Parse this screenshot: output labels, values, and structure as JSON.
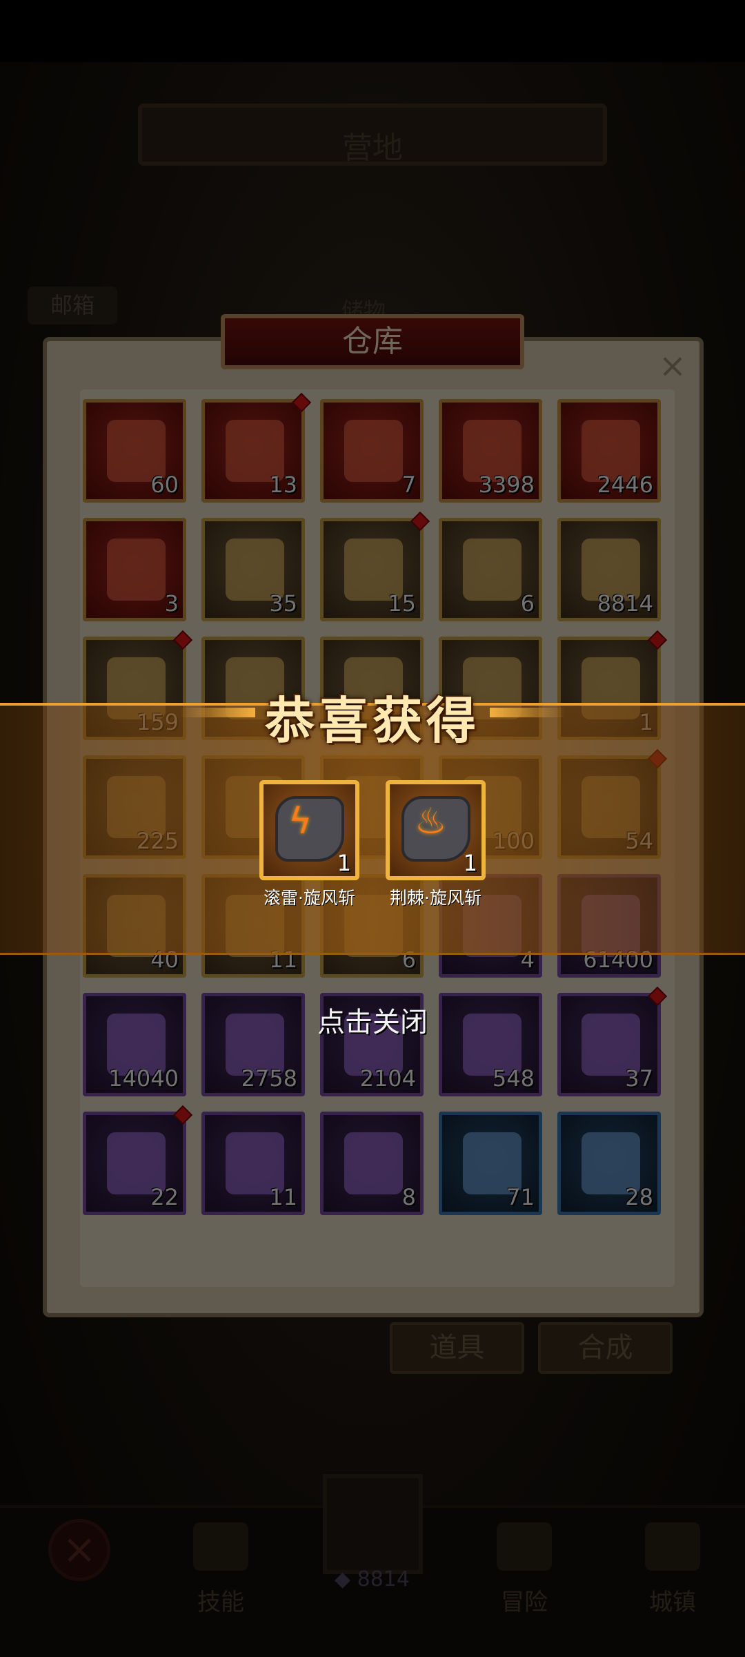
{
  "background": {
    "title": "营地",
    "mailbox": "邮箱",
    "subtitle": "储物",
    "tabs": [
      "道具",
      "合成"
    ],
    "nav": [
      {
        "label": "技能",
        "icon": "book-icon"
      },
      {
        "label": "冒险",
        "icon": "map-icon"
      },
      {
        "label": "城镇",
        "icon": "castle-icon"
      }
    ],
    "gem_count": "8814"
  },
  "warehouse": {
    "title": "仓库",
    "close": "×",
    "items": [
      {
        "count": "60",
        "rarity": "red",
        "icon": "red-potion-icon",
        "alert": false
      },
      {
        "count": "13",
        "rarity": "red",
        "icon": "armor-icon",
        "alert": true
      },
      {
        "count": "7",
        "rarity": "red",
        "icon": "crystal-crown-icon",
        "alert": false
      },
      {
        "count": "3398",
        "rarity": "red",
        "icon": "gold-shard-icon",
        "alert": false
      },
      {
        "count": "2446",
        "rarity": "red",
        "icon": "ruby-icon",
        "alert": false
      },
      {
        "count": "3",
        "rarity": "red",
        "icon": "flame-potion-icon",
        "alert": false
      },
      {
        "count": "35",
        "rarity": "gold",
        "icon": "green-potion-icon",
        "alert": false
      },
      {
        "count": "15",
        "rarity": "gold",
        "icon": "armor-icon",
        "alert": true
      },
      {
        "count": "6",
        "rarity": "gold",
        "icon": "flame-potion-icon",
        "alert": false
      },
      {
        "count": "8814",
        "rarity": "gold",
        "icon": "purple-flame-icon",
        "alert": false
      },
      {
        "count": "159",
        "rarity": "gold",
        "icon": "armor-icon",
        "alert": true
      },
      {
        "count": "",
        "rarity": "gold",
        "icon": "ore-icon",
        "alert": false
      },
      {
        "count": "",
        "rarity": "gold",
        "icon": "ore-icon",
        "alert": false
      },
      {
        "count": "",
        "rarity": "gold",
        "icon": "blue-potion-icon",
        "alert": false
      },
      {
        "count": "1",
        "rarity": "gold",
        "icon": "skull-icon",
        "alert": true
      },
      {
        "count": "225",
        "rarity": "gold",
        "icon": "hammer-icon",
        "alert": false
      },
      {
        "count": "",
        "rarity": "gold",
        "icon": "item-icon",
        "alert": false
      },
      {
        "count": "",
        "rarity": "gold",
        "icon": "item-icon",
        "alert": false
      },
      {
        "count": "100",
        "rarity": "gold",
        "icon": "item-icon",
        "alert": false
      },
      {
        "count": "54",
        "rarity": "gold",
        "icon": "armor-icon",
        "alert": true
      },
      {
        "count": "40",
        "rarity": "gold",
        "icon": "compass-icon",
        "alert": false
      },
      {
        "count": "11",
        "rarity": "gold",
        "icon": "potion-icon",
        "alert": false
      },
      {
        "count": "6",
        "rarity": "gold",
        "icon": "eye-icon",
        "alert": false
      },
      {
        "count": "4",
        "rarity": "purple",
        "icon": "item-icon",
        "alert": false
      },
      {
        "count": "61400",
        "rarity": "purple",
        "icon": "coin-icon",
        "alert": false
      },
      {
        "count": "14040",
        "rarity": "purple",
        "icon": "red-crystals-icon",
        "alert": false
      },
      {
        "count": "2758",
        "rarity": "purple",
        "icon": "gold-ore-icon",
        "alert": false
      },
      {
        "count": "2104",
        "rarity": "purple",
        "icon": "scroll-icon",
        "alert": false
      },
      {
        "count": "548",
        "rarity": "purple",
        "icon": "blue-potion-icon",
        "alert": false
      },
      {
        "count": "37",
        "rarity": "purple",
        "icon": "armor-icon",
        "alert": true
      },
      {
        "count": "22",
        "rarity": "purple",
        "icon": "pouch-icon",
        "alert": true
      },
      {
        "count": "11",
        "rarity": "purple",
        "icon": "sapphire-icon",
        "alert": false
      },
      {
        "count": "8",
        "rarity": "purple",
        "icon": "parchment-icon",
        "alert": false
      },
      {
        "count": "71",
        "rarity": "blue",
        "icon": "ore-pile-icon",
        "alert": false
      },
      {
        "count": "28",
        "rarity": "blue",
        "icon": "purple-rock-icon",
        "alert": false
      }
    ]
  },
  "reward": {
    "title": "恭喜获得",
    "items": [
      {
        "name": "滚雷·旋风斩",
        "count": "1",
        "glyph": "ϟ",
        "icon": "thunder-rune-icon"
      },
      {
        "name": "荆棘·旋风斩",
        "count": "1",
        "glyph": "♨",
        "icon": "fire-rune-icon"
      }
    ],
    "close_hint": "点击关闭"
  }
}
